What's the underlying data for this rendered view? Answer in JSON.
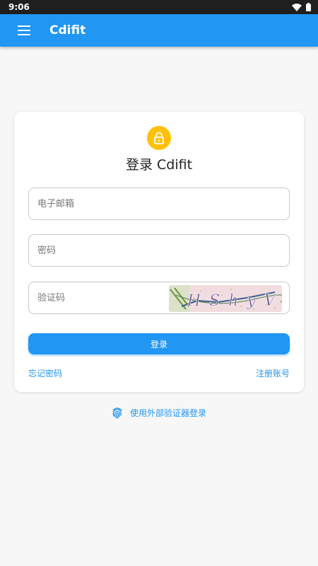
{
  "status_bar": {
    "time": "9:06"
  },
  "app_bar": {
    "title": "Cdifit",
    "menu_icon": "menu-icon"
  },
  "login_card": {
    "lock_icon": "lock-icon",
    "lock_color": "#ffc107",
    "title": "登录 Cdifit",
    "email_placeholder": "电子邮箱",
    "email_value": "",
    "password_placeholder": "密码",
    "password_value": "",
    "captcha_placeholder": "验证码",
    "captcha_value": "",
    "captcha_text": "HShyV",
    "login_label": "登录",
    "forgot_password_label": "忘记密码",
    "register_label": "注册账号"
  },
  "external_login": {
    "label": "使用外部验证器登录",
    "icon": "fingerprint-icon"
  },
  "colors": {
    "primary": "#2196f3",
    "status_bar": "#1f1f1f",
    "background": "#f7f7f7"
  }
}
